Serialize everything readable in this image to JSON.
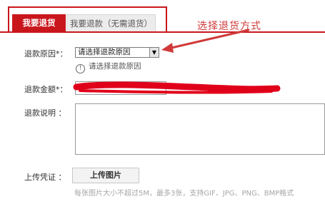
{
  "tabs": {
    "active": "我要退货",
    "inactive": "我要退款（无需退货）"
  },
  "annotation": "选择退货方式",
  "form": {
    "reason_label": "退款原因*：",
    "reason_select_value": "请选择退款原因",
    "reason_hint": "请选择退款原因",
    "amount_label": "退款金额*：",
    "description_label": "退款说明 ：",
    "upload_label": "上传凭证 ：",
    "upload_button": "上传图片",
    "upload_note": "每张图片大小不超过5M，最多3张，支持GIF、JPG、PNG、BMP格式"
  },
  "colors": {
    "accent": "#c9161d",
    "annotation": "#d03a3a",
    "redaction": "#e0001a"
  },
  "icons": {
    "hint": "info-circle-icon",
    "select": "dropdown-arrow-icon"
  }
}
